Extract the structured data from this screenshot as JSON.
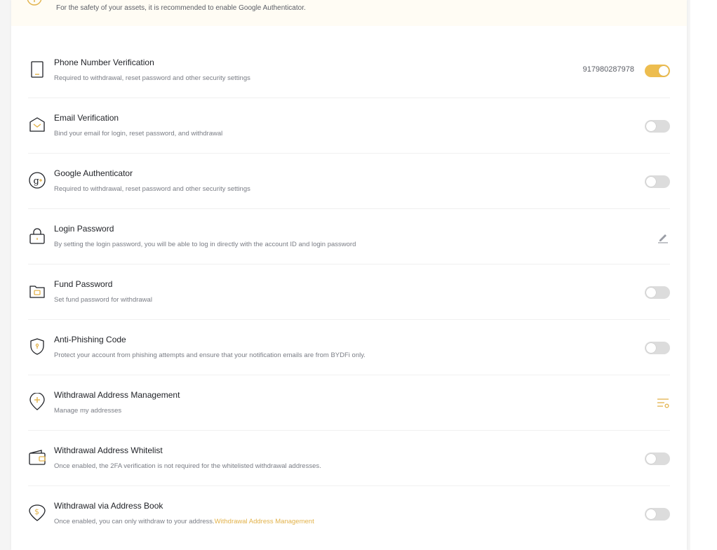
{
  "banner": {
    "text": "For the safety of your assets, it is recommended to enable Google Authenticator.",
    "icon": "info-circle-icon"
  },
  "colors": {
    "accent": "#edbd4f",
    "link": "#e2b24a",
    "toggle_off": "#dcdcdc",
    "banner_bg": "#fffcf4"
  },
  "security_items": [
    {
      "title": "Phone Number Verification",
      "description": "Required to withdrawal, reset password and other security settings",
      "value": "917980287978",
      "control": "toggle",
      "enabled": true,
      "icon": "phone-icon"
    },
    {
      "title": "Email Verification",
      "description": "Bind your email for login, reset password, and withdrawal",
      "control": "toggle",
      "enabled": false,
      "icon": "envelope-icon"
    },
    {
      "title": "Google Authenticator",
      "description": "Required to withdrawal, reset password and other security settings",
      "control": "toggle",
      "enabled": false,
      "icon": "google-authenticator-icon"
    },
    {
      "title": "Login Password",
      "description": "By setting the login password, you will be able to log in directly with the account ID and login password",
      "control": "edit",
      "icon": "lock-icon"
    },
    {
      "title": "Fund Password",
      "description": "Set fund password for withdrawal",
      "control": "toggle",
      "enabled": false,
      "icon": "folder-lock-icon"
    },
    {
      "title": "Anti-Phishing Code",
      "description": "Protect your account from phishing attempts and ensure that your notification emails are from BYDFi only.",
      "control": "toggle",
      "enabled": false,
      "icon": "shield-icon"
    },
    {
      "title": "Withdrawal Address Management",
      "description": "Manage my addresses",
      "control": "manage",
      "icon": "map-pin-plus-icon"
    },
    {
      "title": "Withdrawal Address Whitelist",
      "description": "Once enabled, the 2FA verification is not required for the whitelisted withdrawal addresses.",
      "control": "toggle",
      "enabled": false,
      "icon": "wallet-icon"
    },
    {
      "title": "Withdrawal via Address Book",
      "description": "Once enabled, you can only withdraw to your address.",
      "description_link": "Withdrawal Address Management",
      "control": "toggle",
      "enabled": false,
      "icon": "map-pin-dollar-icon"
    }
  ]
}
